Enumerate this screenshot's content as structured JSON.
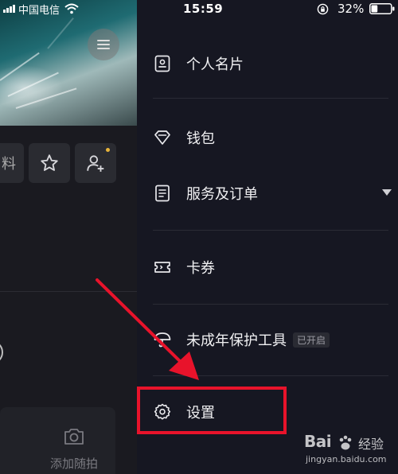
{
  "status_bar": {
    "carrier": "中国电信",
    "time": "15:59",
    "battery_percent": "32%",
    "battery_level": 0.32
  },
  "left_panel": {
    "edit_profile_fragment": "料",
    "camera_button_label": "添加随拍"
  },
  "drawer": {
    "items": [
      {
        "label": "个人名片",
        "icon": "business-card-icon"
      },
      {
        "label": "钱包",
        "icon": "wallet-diamond-icon"
      },
      {
        "label": "服务及订单",
        "icon": "document-list-icon",
        "has_dropdown": true
      },
      {
        "label": "卡券",
        "icon": "ticket-icon"
      },
      {
        "label": "未成年保护工具",
        "icon": "umbrella-icon",
        "badge": "已开启"
      },
      {
        "label": "设置",
        "icon": "gear-icon"
      }
    ]
  },
  "annotation": {
    "highlight_color": "#e8132b",
    "arrow_color": "#e8132b",
    "highlighted_item": "设置"
  },
  "watermark": {
    "brand": "Bai",
    "suffix": "经验",
    "url": "jingyan.baidu.com"
  },
  "colors": {
    "drawer_background": "#161722",
    "left_background": "#1a1a20",
    "text": "#f0f0f2",
    "badge_dot": "#e7b43b"
  }
}
